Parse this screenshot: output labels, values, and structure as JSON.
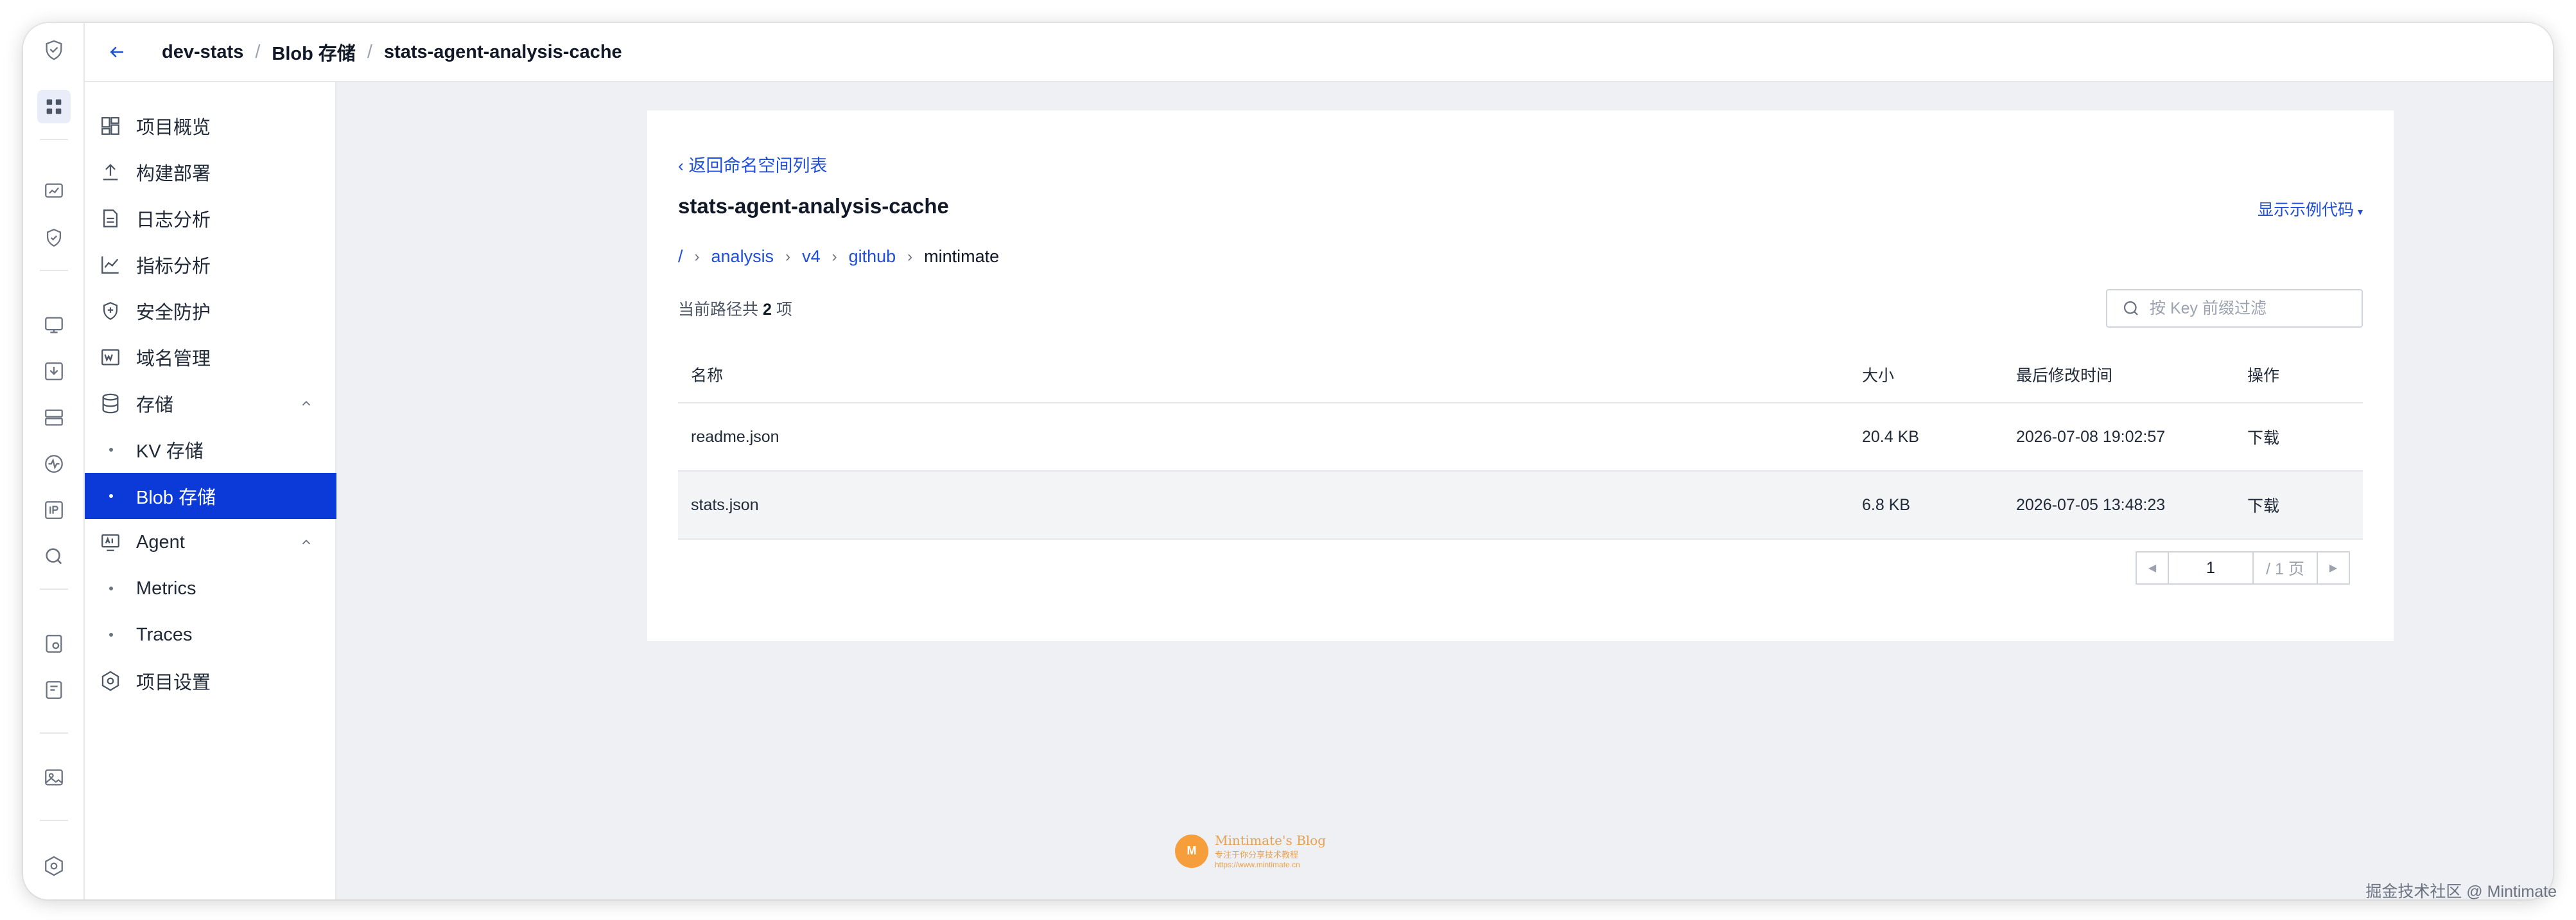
{
  "header": {
    "crumbs": [
      "dev-stats",
      "Blob 存储",
      "stats-agent-analysis-cache"
    ]
  },
  "sidenav": {
    "items": [
      {
        "label": "项目概览",
        "icon": "dashboard-icon"
      },
      {
        "label": "构建部署",
        "icon": "upload-icon"
      },
      {
        "label": "日志分析",
        "icon": "document-icon"
      },
      {
        "label": "指标分析",
        "icon": "chart-line-icon"
      },
      {
        "label": "安全防护",
        "icon": "shield-icon"
      },
      {
        "label": "域名管理",
        "icon": "domain-icon"
      },
      {
        "label": "存储",
        "icon": "database-icon"
      },
      {
        "label": "KV 存储"
      },
      {
        "label": "Blob 存储"
      },
      {
        "label": "Agent",
        "icon": "agent-icon"
      },
      {
        "label": "Metrics"
      },
      {
        "label": "Traces"
      },
      {
        "label": "项目设置",
        "icon": "settings-icon"
      }
    ]
  },
  "main": {
    "back_link": "‹ 返回命名空间列表",
    "title": "stats-agent-analysis-cache",
    "show_code": "显示示例代码",
    "path": {
      "root": "/",
      "segments": [
        "analysis",
        "v4",
        "github"
      ],
      "current": "mintimate"
    },
    "count_prefix": "当前路径共",
    "count_value": "2",
    "count_suffix": "项",
    "search_placeholder": "按 Key 前缀过滤",
    "table": {
      "headers": {
        "name": "名称",
        "size": "大小",
        "time": "最后修改时间",
        "op": "操作"
      },
      "rows": [
        {
          "name": "readme.json",
          "size": "20.4 KB",
          "time": "2026-07-08 19:02:57",
          "op": "下载"
        },
        {
          "name": "stats.json",
          "size": "6.8 KB",
          "time": "2026-07-05 13:48:23",
          "op": "下载"
        }
      ]
    },
    "pager": {
      "page": "1",
      "total": "/ 1 页"
    }
  },
  "watermark": {
    "t1": "Mintimate's Blog",
    "t2": "专注于你分享技术教程",
    "t3": "https://www.mintimate.cn"
  },
  "credit": "掘金技术社区 @ Mintimate",
  "colors": {
    "accent": "#1f4fd8",
    "selected_bg": "#0b3ad8",
    "main_bg": "#eef0f4"
  }
}
